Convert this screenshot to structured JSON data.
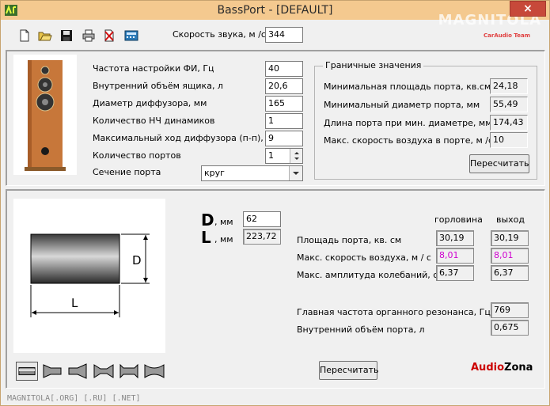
{
  "window": {
    "title": "BassPort - [DEFAULT]",
    "watermark": "MAGNITOLA",
    "watermark_sub": "CarAudio Team",
    "close_glyph": "×"
  },
  "toolbar": {
    "icons": [
      "new-file-icon",
      "open-folder-icon",
      "save-disk-icon",
      "print-icon",
      "delete-icon",
      "calculator-icon"
    ],
    "sound_speed_label": "Скорость звука, м /с",
    "sound_speed_value": "344"
  },
  "params": {
    "tuning_freq_label": "Частота настройки ФИ, Гц",
    "tuning_freq_value": "40",
    "box_volume_label": "Внутренний объём ящика, л",
    "box_volume_value": "20,6",
    "cone_diameter_label": "Диаметр диффузора, мм",
    "cone_diameter_value": "165",
    "woofer_count_label": "Количество НЧ динамиков",
    "woofer_count_value": "1",
    "max_excursion_label": "Максимальный ход диффузора (п-п), мм",
    "max_excursion_value": "9",
    "port_count_label": "Количество портов",
    "port_count_value": "1",
    "port_section_label": "Сечение порта",
    "port_section_value": "круг"
  },
  "limits": {
    "title": "Граничные значения",
    "min_area_label": "Минимальная площадь порта, кв.см.",
    "min_area_value": "24,18",
    "min_diameter_label": "Минимальный диаметр порта, мм",
    "min_diameter_value": "55,49",
    "port_length_label": "Длина порта при мин. диаметре, мм",
    "port_length_value": "174,43",
    "max_air_speed_label": "Макс. скорость воздуха в порте, м /с",
    "max_air_speed_value": "10",
    "recalc_label": "Пересчитать"
  },
  "port": {
    "d_letter": "D",
    "d_unit": ", мм",
    "d_value": "62",
    "l_letter": "L",
    "l_unit": ", мм",
    "l_value": "223,72",
    "diagram_d": "D",
    "diagram_l": "L",
    "col_throat": "горловина",
    "col_exit": "выход",
    "area_label": "Площадь порта, кв. см",
    "area_throat": "30,19",
    "area_exit": "30,19",
    "air_speed_label": "Макс. скорость воздуха, м / с",
    "air_speed_throat": "8,01",
    "air_speed_exit": "8,01",
    "amplitude_label": "Макс. амплитуда колебаний, см",
    "amplitude_throat": "6,37",
    "amplitude_exit": "6,37",
    "resonance_label": "Главная частота органного резонанса, Гц",
    "resonance_value": "769",
    "port_volume_label": "Внутренний объём порта, л",
    "port_volume_value": "0,675",
    "recalc_label": "Пересчитать",
    "shape_icons": [
      "straight-port-icon",
      "flared-port-icon",
      "horn-port-icon",
      "double-flare-port-icon",
      "flanged-port-icon",
      "double-horn-port-icon"
    ]
  },
  "brand": {
    "audio": "Audio",
    "zona": "Zona"
  },
  "status": "MAGNITOLA[.ORG] [.RU] [.NET]",
  "colors": {
    "titlebar": "#f4c98f",
    "highlight": "#d000d0",
    "audio_red": "#cc0000",
    "close": "#c7493a"
  }
}
